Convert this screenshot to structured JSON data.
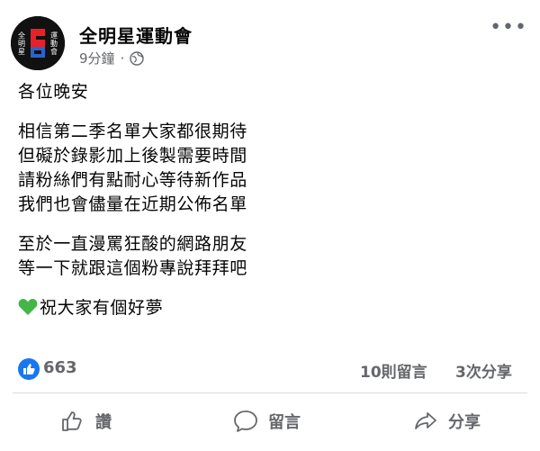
{
  "header": {
    "page_name": "全明星運動會",
    "time": "9分鐘",
    "separator": "·",
    "avatar_logo_text": [
      "全明",
      "星運",
      "動會"
    ]
  },
  "post": {
    "lines": [
      "各位晚安",
      "",
      "相信第二季名單大家都很期待",
      "但礙於錄影加上後製需要時間",
      "請粉絲們有點耐心等待新作品",
      "我們也會儘量在近期公佈名單",
      "",
      "至於一直漫罵狂酸的網路朋友",
      "等一下就跟這個粉專說拜拜吧",
      "",
      "祝大家有個好夢"
    ],
    "heart_icon": "green-heart-emoji"
  },
  "stats": {
    "likes": "663",
    "comments": "10則留言",
    "shares": "3次分享"
  },
  "actions": {
    "like": "讚",
    "comment": "留言",
    "share": "分享"
  },
  "colors": {
    "brand_blue": "#1877f2",
    "muted_text": "#65676b",
    "divider": "#dadde1",
    "heart_green": "#43b649"
  }
}
